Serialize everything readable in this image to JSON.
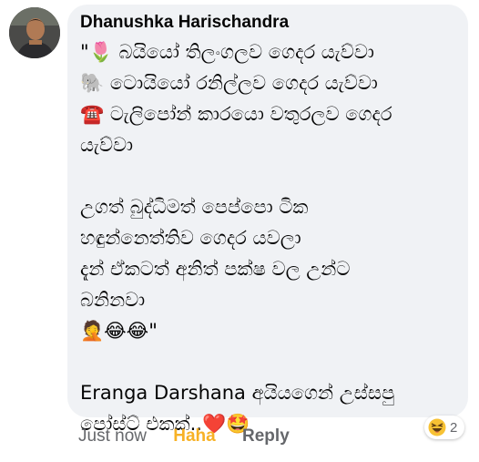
{
  "comment": {
    "author": "Dhanushka Harischandra",
    "lines": [
      {
        "icon": "tulip-icon",
        "text": "\"🌷 බයියෝ තිලංගලව ගෙදර යැව්වා"
      },
      {
        "icon": "elephant-icon",
        "text": "🐘 ටොයියෝ රනිල්ලව ගෙදර යැව්වා"
      },
      {
        "icon": "telephone-icon",
        "text": "☎️ ටැලිපෝන් කාරයො වතුරලව ගෙදර"
      },
      {
        "text": "යැව්වා"
      },
      {
        "text": ""
      },
      {
        "text": "උගත් බුද්ධිමත් පෙප්පො ටික"
      },
      {
        "text": "හඳුන්නෙත්තිව ගෙදර යවලා"
      },
      {
        "text": "දැන් ඒකටත් අනිත් පක්ෂ වල උන්ට"
      },
      {
        "text": "බනිනවා"
      },
      {
        "icon": "facepalm-laugh-icons",
        "text": "🤦😂😂\""
      },
      {
        "text": ""
      },
      {
        "text": "Eranga Darshana අයියගෙන් උස්සපු"
      },
      {
        "icon": "heart-star-icons",
        "text": "පෝස්ට් එකක්..❤️🤩"
      }
    ]
  },
  "actions": {
    "time": "Just now",
    "reaction_label": "Haha",
    "reply_label": "Reply"
  },
  "reaction_summary": {
    "icon": "haha-emoji-icon",
    "count": "2"
  },
  "colors": {
    "bubble": "#f0f2f5",
    "haha": "#f7b125",
    "muted": "#65676b"
  }
}
